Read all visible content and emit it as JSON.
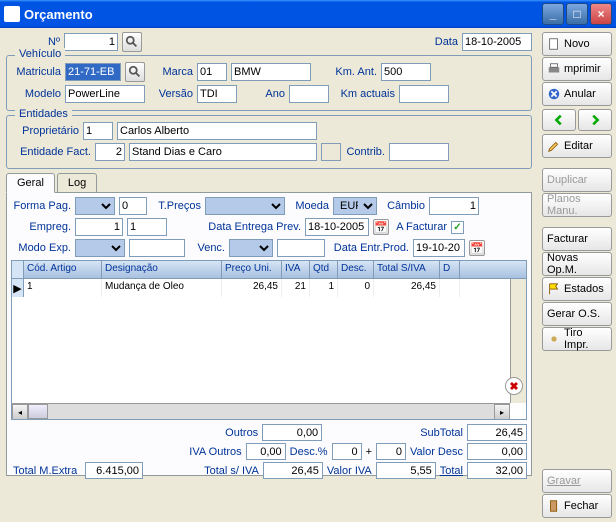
{
  "window": {
    "title": "Orçamento"
  },
  "top": {
    "num_label": "Nº",
    "num_value": "1",
    "date_label": "Data",
    "date_value": "18-10-2005"
  },
  "vehicle": {
    "group": "Vehículo",
    "matricula_label": "Matricula",
    "matricula_value": "21-71-EB",
    "marca_label": "Marca",
    "marca_code": "01",
    "marca_name": "BMW",
    "kmant_label": "Km. Ant.",
    "kmant_value": "500",
    "modelo_label": "Modelo",
    "modelo_value": "PowerLine",
    "versao_label": "Versão",
    "versao_value": "TDI",
    "ano_label": "Ano",
    "ano_value": "",
    "kmact_label": "Km actuais",
    "kmact_value": ""
  },
  "entities": {
    "group": "Entidades",
    "prop_label": "Proprietário",
    "prop_code": "1",
    "prop_name": "Carlos Alberto",
    "ent_label": "Entidade Fact.",
    "ent_code": "2",
    "ent_name": "Stand Dias e Caro",
    "contrib_label": "Contrib.",
    "contrib_value": ""
  },
  "tabs": {
    "geral": "Geral",
    "log": "Log"
  },
  "form": {
    "formapag_label": "Forma Pag.",
    "formapag_code": "0",
    "tprecos_label": "T.Preços",
    "moeda_label": "Moeda",
    "moeda_value": "EUR",
    "cambio_label": "Câmbio",
    "cambio_value": "1",
    "empreg_label": "Empreg.",
    "empreg_value": "1",
    "empreg_value2": "1",
    "dataentrega_label": "Data Entrega Prev.",
    "dataentrega_value": "18-10-2005",
    "facturar_label": "A Facturar",
    "modo_label": "Modo Exp.",
    "venc_label": "Venc.",
    "dataprod_label": "Data Entr.Prod.",
    "dataprod_value": "19-10-20"
  },
  "grid": {
    "headers": {
      "cod": "Cód. Artigo",
      "desig": "Designação",
      "preco": "Preço Uni.",
      "iva": "IVA",
      "qtd": "Qtd",
      "desc": "Desc.",
      "tsiva": "Total S/IVA",
      "d": "D"
    },
    "rows": [
      {
        "cod": "1",
        "desig": "Mudança de Oleo",
        "preco": "26,45",
        "iva": "21",
        "qtd": "1",
        "desc": "0",
        "tsiva": "26,45"
      }
    ]
  },
  "totals": {
    "outros_label": "Outros",
    "outros": "0,00",
    "subtotal_label": "SubTotal",
    "subtotal": "26,45",
    "ivaoutros_label": "IVA Outros",
    "ivaoutros": "0,00",
    "descperc_label": "Desc.%",
    "descperc1": "0",
    "descperc2": "0",
    "valordesc_label": "Valor Desc",
    "valordesc": "0,00",
    "mextra_label": "Total M.Extra",
    "mextra": "6.415,00",
    "totalsiva_label": "Total s/ IVA",
    "totalsiva": "26,45",
    "valoriva_label": "Valor IVA",
    "valoriva": "5,55",
    "total_label": "Total",
    "total": "32,00"
  },
  "sidebar": {
    "novo": "Novo",
    "imprimir": "mprimir",
    "anular": "Anular",
    "editar": "Editar",
    "duplicar": "Duplicar",
    "planos": "Planos Manu.",
    "facturar": "Facturar",
    "novasopm": "Novas Op.M.",
    "estados": "Estados",
    "geraros": "Gerar O.S.",
    "tiroimpr": "Tiro Impr.",
    "gravar": "Gravar",
    "fechar": "Fechar"
  }
}
